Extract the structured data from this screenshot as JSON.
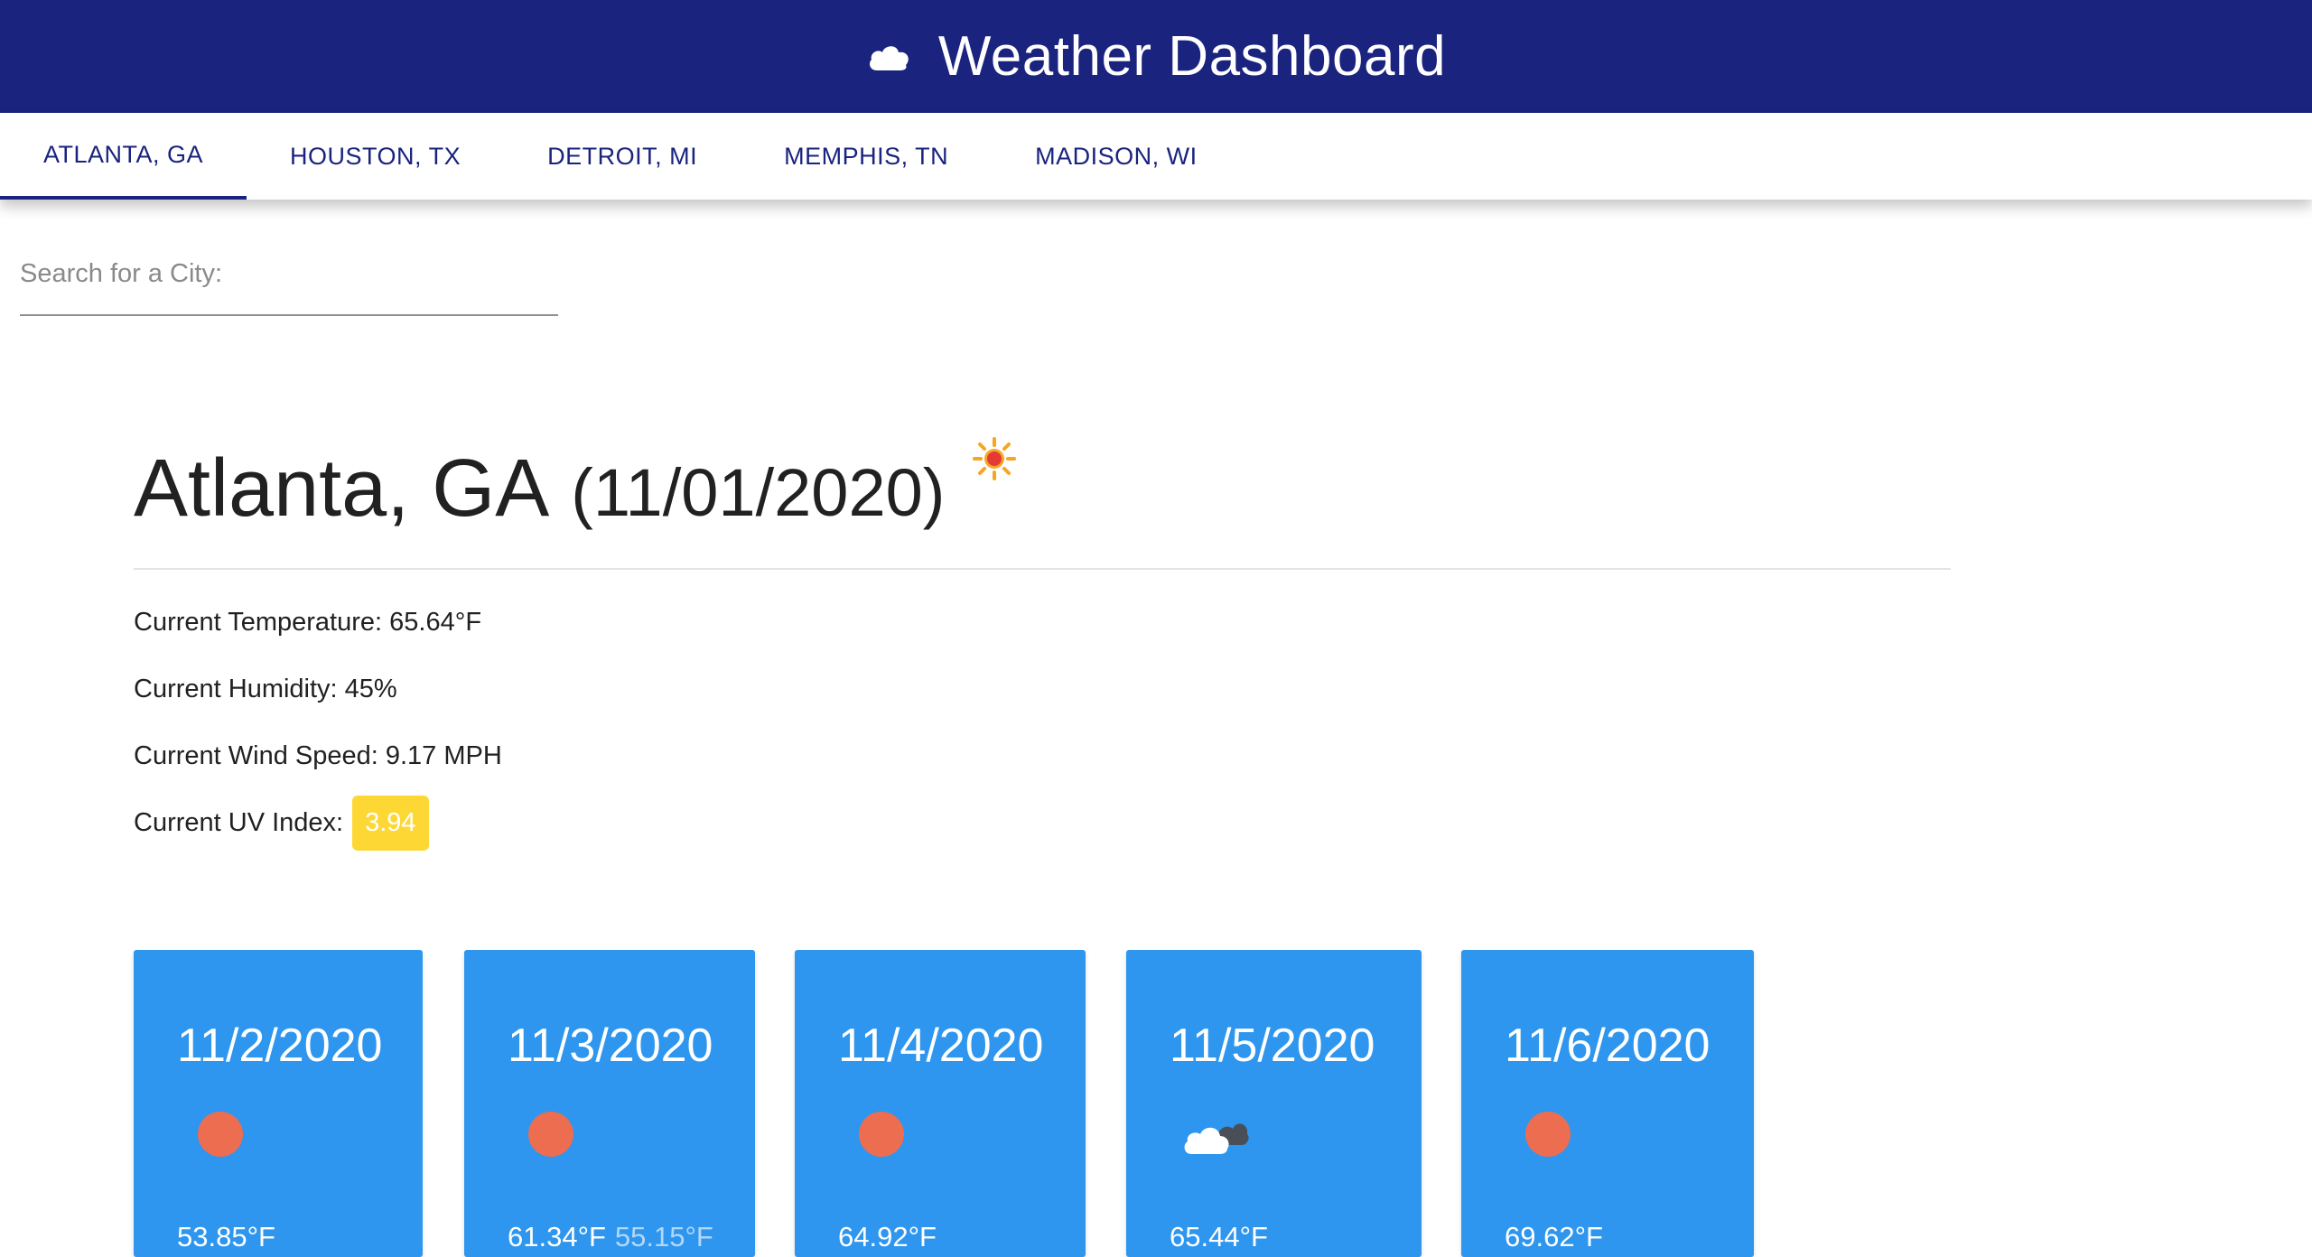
{
  "header": {
    "title": "Weather Dashboard",
    "icon": "cloud-icon"
  },
  "tabs": [
    {
      "label": "Atlanta, GA",
      "active": true
    },
    {
      "label": "Houston, TX",
      "active": false
    },
    {
      "label": "Detroit, MI",
      "active": false
    },
    {
      "label": "Memphis, TN",
      "active": false
    },
    {
      "label": "Madison, WI",
      "active": false
    }
  ],
  "search": {
    "placeholder": "Search for a City:",
    "value": ""
  },
  "current": {
    "city": "Atlanta, GA",
    "date": "(11/01/2020)",
    "icon": "sun-icon",
    "temperature": "Current Temperature: 65.64°F",
    "humidity": "Current Humidity: 45%",
    "wind": "Current Wind Speed: 9.17 MPH",
    "uv_label": "Current UV Index:",
    "uv_value": "3.94",
    "uv_color": "#fdd835"
  },
  "forecast": [
    {
      "date": "11/2/2020",
      "icon": "sun-icon",
      "high": "53.85°F",
      "low": ""
    },
    {
      "date": "11/3/2020",
      "icon": "sun-icon",
      "high": "61.34°F",
      "low": "55.15°F"
    },
    {
      "date": "11/4/2020",
      "icon": "sun-icon",
      "high": "64.92°F",
      "low": ""
    },
    {
      "date": "11/5/2020",
      "icon": "cloudy-icon",
      "high": "65.44°F",
      "low": ""
    },
    {
      "date": "11/6/2020",
      "icon": "sun-icon",
      "high": "69.62°F",
      "low": ""
    }
  ],
  "colors": {
    "header_bg": "#1a237e",
    "card_bg": "#2e96ee",
    "uv_badge": "#fdd835",
    "sun": "#ec6d50"
  }
}
